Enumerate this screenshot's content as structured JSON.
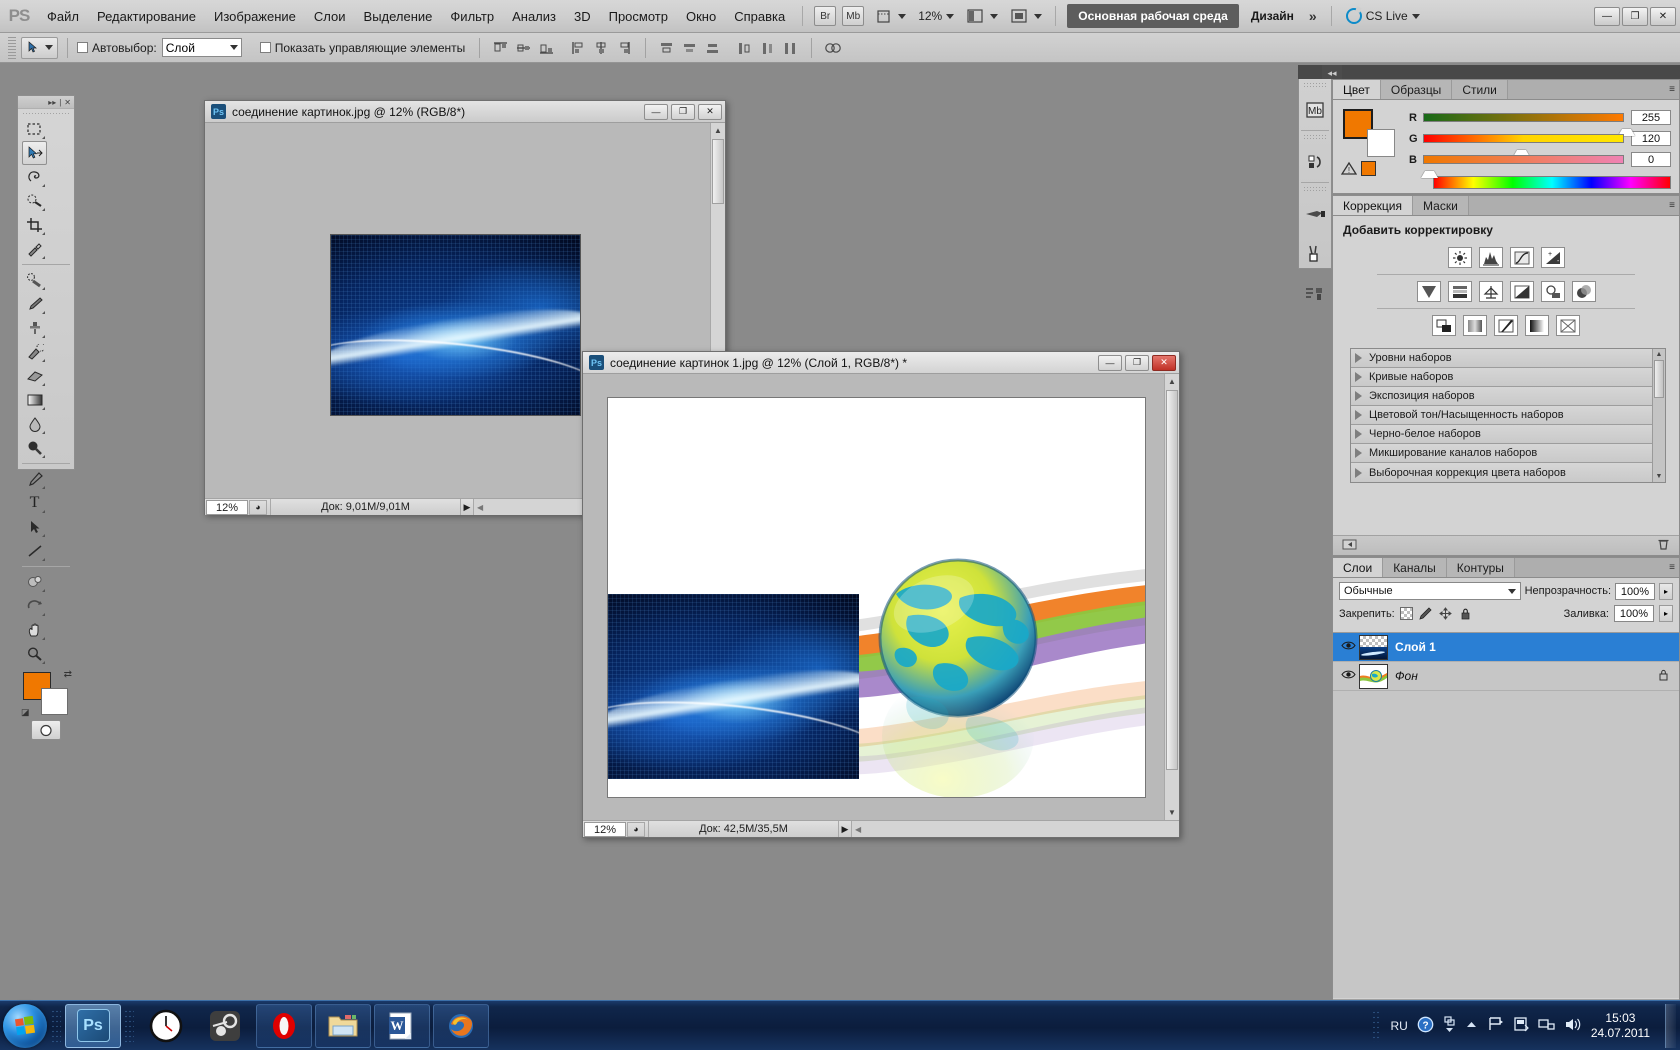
{
  "app": {
    "logo": "PS",
    "menus": [
      "Файл",
      "Редактирование",
      "Изображение",
      "Слои",
      "Выделение",
      "Фильтр",
      "Анализ",
      "3D",
      "Просмотр",
      "Окно",
      "Справка"
    ],
    "bridge_label": "Br",
    "minibridge_label": "Mb",
    "zoom_level": "12%",
    "workspace_active": "Основная рабочая среда",
    "workspace_other": "Дизайн",
    "workspace_more": "»",
    "cs_live": "CS Live",
    "window_buttons": [
      "—",
      "❐",
      "✕"
    ]
  },
  "options_bar": {
    "autoselect_label": "Автовыбор:",
    "autoselect_value": "Слой",
    "show_controls_label": "Показать управляющие элементы",
    "align_group_1": [
      "align-top-edges",
      "align-vertical-centers",
      "align-bottom-edges"
    ],
    "align_group_2": [
      "align-left-edges",
      "align-horizontal-centers",
      "align-right-edges"
    ],
    "distribute_group_1": [
      "distribute-top-edges",
      "distribute-vertical-centers",
      "distribute-bottom-edges"
    ],
    "distribute_group_2": [
      "distribute-left-edges",
      "distribute-horizontal-centers",
      "distribute-right-edges"
    ],
    "auto_align": "auto-align-layers"
  },
  "toolbox": {
    "collapse": "▸▸",
    "close": "✕",
    "tools": [
      {
        "name": "rectangular-marquee-tool",
        "glyph": "▫"
      },
      {
        "name": "move-tool",
        "glyph": "✥",
        "selected": true
      },
      {
        "name": "lasso-tool",
        "glyph": "𝒫"
      },
      {
        "name": "quick-selection-tool",
        "glyph": "✎"
      },
      {
        "name": "crop-tool",
        "glyph": "⌗"
      },
      {
        "name": "eyedropper-tool",
        "glyph": "✒"
      },
      {
        "name": "spot-healing-brush-tool",
        "glyph": "⌇"
      },
      {
        "name": "brush-tool",
        "glyph": "🖌"
      },
      {
        "name": "clone-stamp-tool",
        "glyph": "⎙"
      },
      {
        "name": "history-brush-tool",
        "glyph": "↯"
      },
      {
        "name": "eraser-tool",
        "glyph": "▰"
      },
      {
        "name": "gradient-tool",
        "glyph": "▤"
      },
      {
        "name": "blur-tool",
        "glyph": "💧"
      },
      {
        "name": "dodge-tool",
        "glyph": "⬤"
      },
      {
        "name": "pen-tool",
        "glyph": "✑"
      },
      {
        "name": "horizontal-type-tool",
        "glyph": "T"
      },
      {
        "name": "path-selection-tool",
        "glyph": "➤"
      },
      {
        "name": "line-tool",
        "glyph": "╱"
      },
      {
        "name": "3d-rotate-tool",
        "glyph": "◕"
      },
      {
        "name": "3d-orbit-tool",
        "glyph": "⟳"
      },
      {
        "name": "hand-tool",
        "glyph": "✋"
      },
      {
        "name": "zoom-tool",
        "glyph": "🔍"
      }
    ],
    "foreground_color": "#F07800",
    "background_color": "#FFFFFF",
    "quick_mask": "quick-mask-mode"
  },
  "documents": [
    {
      "title": "соединение картинок.jpg @ 12% (RGB/8*)",
      "zoom": "12%",
      "doc_info": "Док: 9,01M/9,01M",
      "active": false,
      "buttons": [
        "—",
        "❐",
        "✕"
      ]
    },
    {
      "title": "соединение картинок 1.jpg @ 12% (Слой 1, RGB/8*) *",
      "zoom": "12%",
      "doc_info": "Док: 42,5M/35,5M",
      "active": true,
      "buttons": [
        "—",
        "❐",
        "✕"
      ]
    }
  ],
  "icon_rail": [
    {
      "name": "mini-bridge-icon",
      "glyph": "Mb"
    },
    {
      "name": "history-icon",
      "glyph": "↻"
    },
    {
      "name": "tool-presets-icon",
      "glyph": "✎"
    },
    {
      "name": "brush-presets-icon",
      "glyph": "🖌"
    },
    {
      "name": "clone-source-icon",
      "glyph": "⎘"
    }
  ],
  "color_panel": {
    "tabs": [
      {
        "label": "Цвет",
        "active": true
      },
      {
        "label": "Образцы",
        "active": false
      },
      {
        "label": "Стили",
        "active": false
      }
    ],
    "channels": [
      {
        "label": "R",
        "value": "255",
        "thumb_pct": 100
      },
      {
        "label": "G",
        "value": "120",
        "thumb_pct": 47
      },
      {
        "label": "B",
        "value": "0",
        "thumb_pct": 0
      }
    ],
    "foreground": "#F07800",
    "background": "#FFFFFF",
    "out_of_gamut_swatch": "#F07800",
    "menu_glyph": "≡"
  },
  "adjustments_panel": {
    "tabs": [
      {
        "label": "Коррекция",
        "active": true
      },
      {
        "label": "Маски",
        "active": false
      }
    ],
    "heading": "Добавить корректировку",
    "icon_rows": [
      [
        {
          "name": "brightness-contrast-icon",
          "glyph": "☀"
        },
        {
          "name": "levels-icon",
          "glyph": "▥"
        },
        {
          "name": "curves-icon",
          "glyph": "∿"
        },
        {
          "name": "exposure-icon",
          "glyph": "◩"
        }
      ],
      [
        {
          "name": "vibrance-icon",
          "glyph": "▽"
        },
        {
          "name": "hue-saturation-icon",
          "glyph": "▤"
        },
        {
          "name": "color-balance-icon",
          "glyph": "⚖"
        },
        {
          "name": "black-white-icon",
          "glyph": "◨"
        },
        {
          "name": "photo-filter-icon",
          "glyph": "⌾"
        },
        {
          "name": "channel-mixer-icon",
          "glyph": "◍"
        }
      ],
      [
        {
          "name": "invert-icon",
          "glyph": "▣"
        },
        {
          "name": "posterize-icon",
          "glyph": "▩"
        },
        {
          "name": "threshold-icon",
          "glyph": "◪"
        },
        {
          "name": "gradient-map-icon",
          "glyph": "▥"
        },
        {
          "name": "selective-color-icon",
          "glyph": "⊠"
        }
      ]
    ],
    "presets": [
      "Уровни наборов",
      "Кривые наборов",
      "Экспозиция наборов",
      "Цветовой тон/Насыщенность наборов",
      "Черно-белое наборов",
      "Микширование каналов наборов",
      "Выборочная коррекция цвета наборов"
    ],
    "footer_left": "return-to-adjustment-list-icon",
    "footer_right": "delete-adjustment-icon"
  },
  "layers_panel": {
    "tabs": [
      {
        "label": "Слои",
        "active": true
      },
      {
        "label": "Каналы",
        "active": false
      },
      {
        "label": "Контуры",
        "active": false
      }
    ],
    "blend_mode": "Обычные",
    "opacity_label": "Непрозрачность:",
    "opacity_value": "100%",
    "lock_label": "Закрепить:",
    "fill_label": "Заливка:",
    "fill_value": "100%",
    "lock_icons": [
      "lock-transparent-pixels-icon",
      "lock-image-pixels-icon",
      "lock-position-icon",
      "lock-all-icon"
    ],
    "layers": [
      {
        "name": "Слой 1",
        "selected": true,
        "visible": true,
        "locked": false,
        "italic": false,
        "thumb": "transparent-blue-wave"
      },
      {
        "name": "Фон",
        "selected": false,
        "visible": true,
        "locked": true,
        "italic": true,
        "thumb": "globe-ribbons"
      }
    ],
    "footer_icons": [
      {
        "name": "link-layers-icon",
        "glyph": "🔗"
      },
      {
        "name": "layer-style-icon",
        "glyph": "fx"
      },
      {
        "name": "layer-mask-icon",
        "glyph": "◉"
      },
      {
        "name": "adjustment-layer-icon",
        "glyph": "◐"
      },
      {
        "name": "new-group-icon",
        "glyph": "▭"
      },
      {
        "name": "new-layer-icon",
        "glyph": "❐"
      },
      {
        "name": "delete-layer-icon",
        "glyph": "🗑"
      }
    ]
  },
  "taskbar": {
    "start": "start-orb",
    "buttons": [
      {
        "name": "taskbar-photoshop",
        "glyph": "Ps",
        "active": true
      },
      {
        "name": "taskbar-clock-widget",
        "glyph": "🕐",
        "active": false
      },
      {
        "name": "taskbar-steam",
        "glyph": "◓",
        "active": false
      },
      {
        "name": "taskbar-opera",
        "glyph": "O",
        "active": false
      },
      {
        "name": "taskbar-explorer",
        "glyph": "🗂",
        "active": false
      },
      {
        "name": "taskbar-word",
        "glyph": "W",
        "active": false
      },
      {
        "name": "taskbar-firefox",
        "glyph": "🦊",
        "active": false
      }
    ],
    "tray": {
      "language": "RU",
      "icons": [
        "help-icon",
        "network-expand-icon",
        "show-hidden-icons-icon",
        "flag-action-center-icon",
        "device-icon",
        "network-icon",
        "volume-icon"
      ],
      "time": "15:03",
      "date": "24.07.2011"
    }
  }
}
